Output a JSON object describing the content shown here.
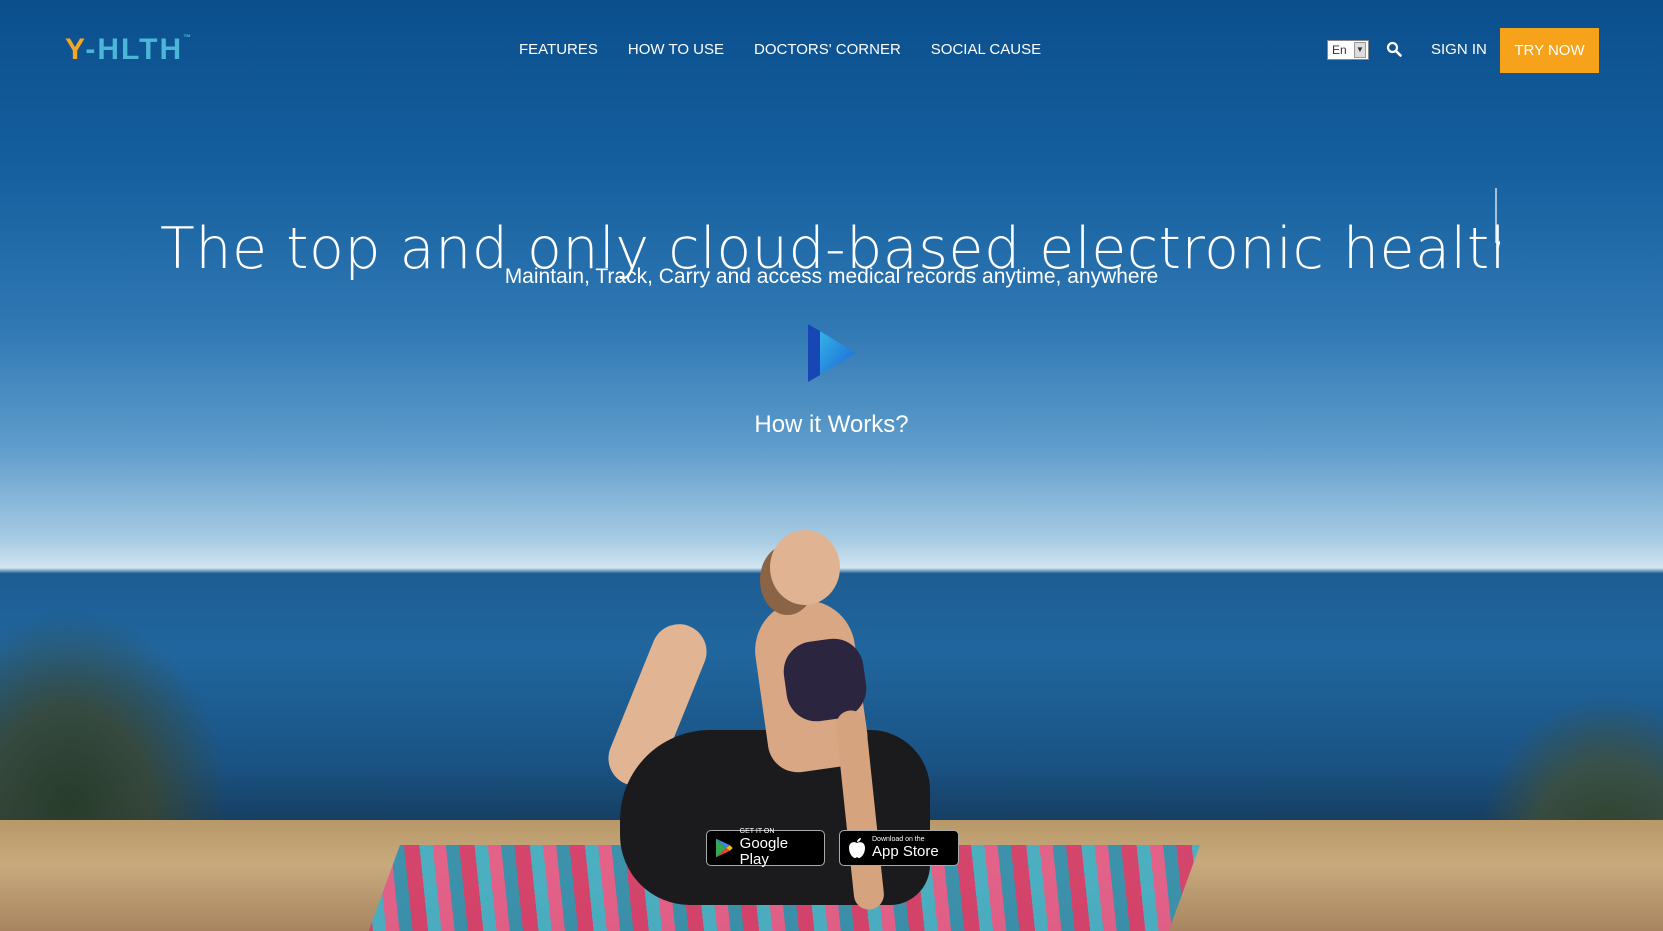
{
  "brand": {
    "logo_text_y": "Y",
    "logo_text_rest": "-HLTH",
    "trademark": "™"
  },
  "nav": {
    "items": [
      "FEATURES",
      "HOW TO USE",
      "DOCTORS' CORNER",
      "SOCIAL CAUSE"
    ],
    "language": "En",
    "signin_label": "SIGN IN",
    "try_label": "TRY NOW",
    "try_color": "#f7a21b"
  },
  "hero": {
    "headline": "The top and only cloud-based electronic health reco",
    "subheadline": "Maintain, Track, Carry and access medical records anytime, anywhere",
    "how_label": "How it Works?",
    "play_icon": "play-icon"
  },
  "stores": {
    "google": {
      "small": "GET IT ON",
      "big": "Google Play"
    },
    "apple": {
      "small": "Download on the",
      "big": "App Store"
    }
  }
}
